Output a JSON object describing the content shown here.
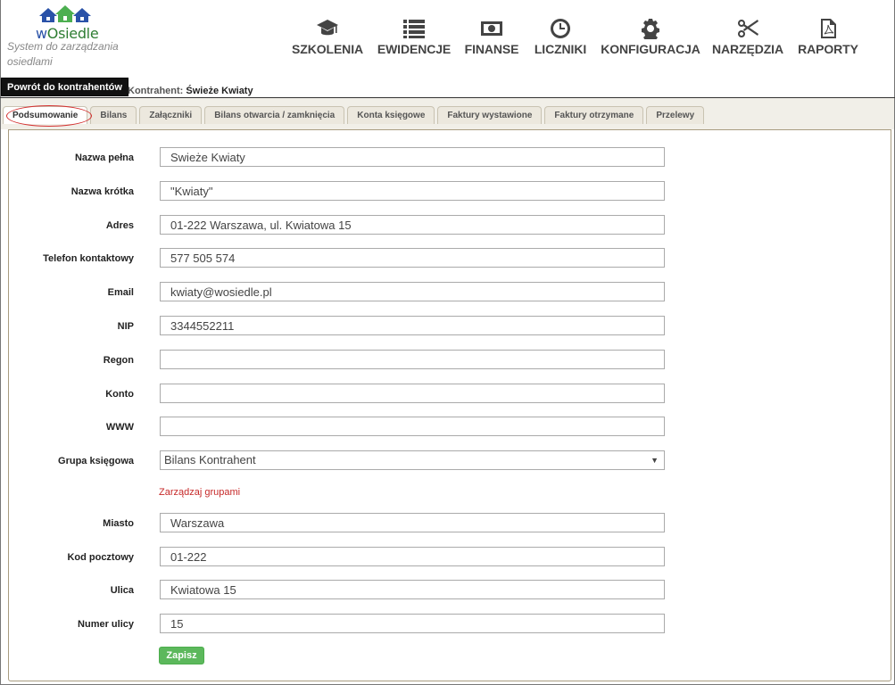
{
  "brand": {
    "logo_text_w": "w",
    "logo_text_rest": "Osiedle",
    "tagline": "System do zarządzania osiedlami",
    "colors": {
      "logo_green": "#2e7d32",
      "logo_blue": "#2a52a8"
    }
  },
  "nav": [
    {
      "label": "SZKOLENIA",
      "icon": "graduation-cap-icon"
    },
    {
      "label": "EWIDENCJE",
      "icon": "list-icon"
    },
    {
      "label": "FINANSE",
      "icon": "money-icon"
    },
    {
      "label": "LICZNIKI",
      "icon": "clock-icon"
    },
    {
      "label": "KONFIGURACJA",
      "icon": "gear-icon"
    },
    {
      "label": "NARZĘDZIA",
      "icon": "scissors-icon"
    },
    {
      "label": "RAPORTY",
      "icon": "pdf-file-icon"
    }
  ],
  "back_button": "Powrót do kontrahentów",
  "contractor": {
    "label": "Kontrahent:",
    "value": "Świeże Kwiaty"
  },
  "tabs": [
    {
      "label": "Podsumowanie",
      "active": true
    },
    {
      "label": "Bilans"
    },
    {
      "label": "Załączniki"
    },
    {
      "label": "Bilans otwarcia / zamknięcia"
    },
    {
      "label": "Konta księgowe"
    },
    {
      "label": "Faktury wystawione"
    },
    {
      "label": "Faktury otrzymane"
    },
    {
      "label": "Przelewy"
    }
  ],
  "form": {
    "nazwa_pelna": {
      "label": "Nazwa pełna",
      "value": "Swieże Kwiaty"
    },
    "nazwa_krotka": {
      "label": "Nazwa krótka",
      "value": "\"Kwiaty\""
    },
    "adres": {
      "label": "Adres",
      "value": "01-222 Warszawa, ul. Kwiatowa 15"
    },
    "telefon": {
      "label": "Telefon kontaktowy",
      "value": "577 505 574"
    },
    "email": {
      "label": "Email",
      "value": "kwiaty@wosiedle.pl"
    },
    "nip": {
      "label": "NIP",
      "value": "3344552211"
    },
    "regon": {
      "label": "Regon",
      "value": ""
    },
    "konto": {
      "label": "Konto",
      "value": ""
    },
    "www": {
      "label": "WWW",
      "value": ""
    },
    "grupa": {
      "label": "Grupa księgowa",
      "value": "Bilans Kontrahent",
      "arrow": "▼"
    },
    "manage_groups": "Zarządzaj grupami",
    "miasto": {
      "label": "Miasto",
      "value": "Warszawa"
    },
    "kod": {
      "label": "Kod pocztowy",
      "value": "01-222"
    },
    "ulica": {
      "label": "Ulica",
      "value": "Kwiatowa 15"
    },
    "numer": {
      "label": "Numer ulicy",
      "value": "15"
    },
    "save": "Zapisz"
  }
}
